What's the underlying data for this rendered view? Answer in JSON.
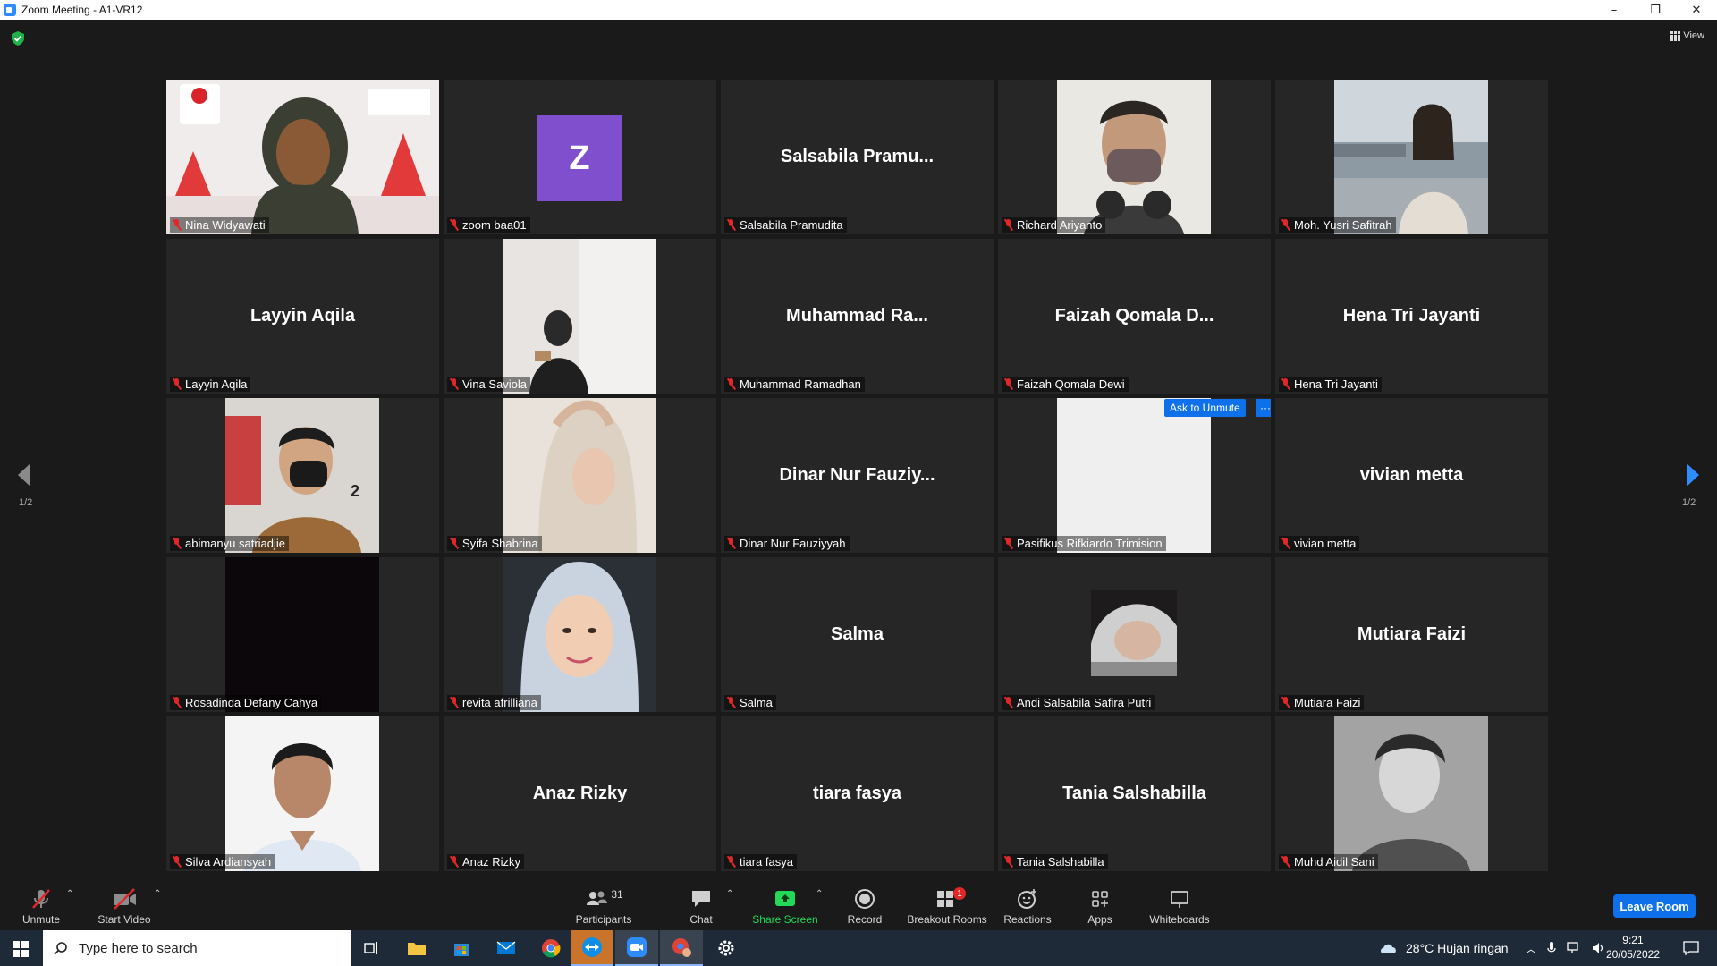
{
  "window": {
    "title": "Zoom Meeting - A1-VR12",
    "minimize": "–",
    "maximize": "❐",
    "close": "✕"
  },
  "header": {
    "view_label": "View"
  },
  "pagination": {
    "left": "1/2",
    "right": "1/2"
  },
  "tiles": [
    {
      "name": "Nina Widyawati",
      "kind": "video",
      "active": true
    },
    {
      "name": "zoom baa01",
      "kind": "avatar",
      "avatar_letter": "Z"
    },
    {
      "name": "Salsabila Pramudita",
      "kind": "name",
      "big": "Salsabila  Pramu..."
    },
    {
      "name": "Richard Ariyanto",
      "kind": "video"
    },
    {
      "name": "Moh. Yusri Safitrah",
      "kind": "video"
    },
    {
      "name": "Layyin Aqila",
      "kind": "name",
      "big": "Layyin Aqila"
    },
    {
      "name": "Vina Saviola",
      "kind": "video"
    },
    {
      "name": "Muhammad Ramadhan",
      "kind": "name",
      "big": "Muhammad  Ra..."
    },
    {
      "name": "Faizah Qomala Dewi",
      "kind": "name",
      "big": "Faizah Qomala  D..."
    },
    {
      "name": "Hena Tri Jayanti",
      "kind": "name",
      "big": "Hena Tri Jayanti"
    },
    {
      "name": "abimanyu satriadjie",
      "kind": "video"
    },
    {
      "name": "Syifa Shabrina",
      "kind": "video"
    },
    {
      "name": "Dinar Nur Fauziyyah",
      "kind": "name",
      "big": "Dinar  Nur  Fauziy..."
    },
    {
      "name": "Pasifikus Rifkiardo Trimision",
      "kind": "video",
      "ask_unmute": "Ask to Unmute",
      "more": "···"
    },
    {
      "name": "vivian metta",
      "kind": "name",
      "big": "vivian metta"
    },
    {
      "name": "Rosadinda Defany Cahya",
      "kind": "video"
    },
    {
      "name": "revita afrilliana",
      "kind": "video"
    },
    {
      "name": "Salma",
      "kind": "name",
      "big": "Salma"
    },
    {
      "name": "Andi Salsabila Safira Putri",
      "kind": "video"
    },
    {
      "name": "Mutiara Faizi",
      "kind": "name",
      "big": "Mutiara Faizi"
    },
    {
      "name": "Silva Ardiansyah",
      "kind": "video"
    },
    {
      "name": "Anaz Rizky",
      "kind": "name",
      "big": "Anaz Rizky"
    },
    {
      "name": "tiara fasya",
      "kind": "name",
      "big": "tiara fasya"
    },
    {
      "name": "Tania Salshabilla",
      "kind": "name",
      "big": "Tania Salshabilla"
    },
    {
      "name": "Muhd Aidil Sani",
      "kind": "video"
    }
  ],
  "toolbar": {
    "unmute": "Unmute",
    "start_video": "Start Video",
    "participants": "Participants",
    "participants_count": "31",
    "chat": "Chat",
    "share_screen": "Share Screen",
    "record": "Record",
    "breakout_rooms": "Breakout Rooms",
    "breakout_badge": "1",
    "reactions": "Reactions",
    "apps": "Apps",
    "whiteboards": "Whiteboards",
    "leave": "Leave Room"
  },
  "taskbar": {
    "search_placeholder": "Type here to search",
    "weather": "28°C  Hujan ringan",
    "time": "9:21",
    "date": "20/05/2022"
  },
  "colors": {
    "accent": "#0e71eb",
    "active_speaker": "#f0f000",
    "share_green": "#23d959",
    "muted_red": "#e02828"
  }
}
